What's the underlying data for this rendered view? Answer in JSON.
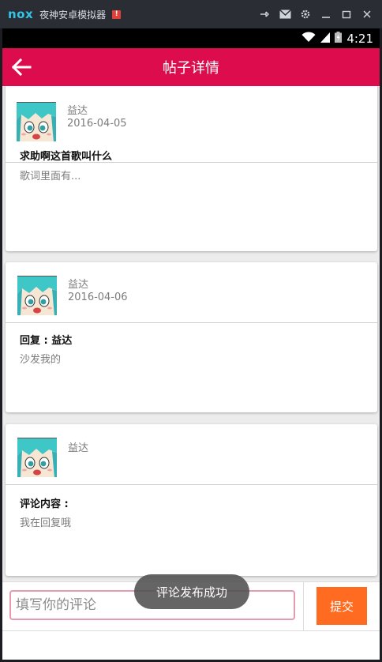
{
  "emulator": {
    "logo": "nox",
    "title": "夜神安卓模拟器",
    "badge": "!"
  },
  "status_bar": {
    "time": "4:21"
  },
  "app_bar": {
    "title": "帖子详情"
  },
  "post": {
    "author": "益达",
    "date": "2016-04-05",
    "title": "求助啊这首歌叫什么",
    "content": "歌词里面有..."
  },
  "comments": [
    {
      "author": "益达",
      "date": "2016-04-06",
      "label": "回复 : 益达",
      "text": "沙发我的"
    },
    {
      "author": "益达",
      "date": "",
      "label": "评论内容 :",
      "text": "我在回复哦"
    }
  ],
  "comment_box": {
    "placeholder": "填写你的评论",
    "submit_label": "提交"
  },
  "toast": {
    "text": "评论发布成功"
  },
  "colors": {
    "app_bar": "#dd0d4d",
    "submit": "#ff6b20",
    "input_border": "#e79aae"
  }
}
